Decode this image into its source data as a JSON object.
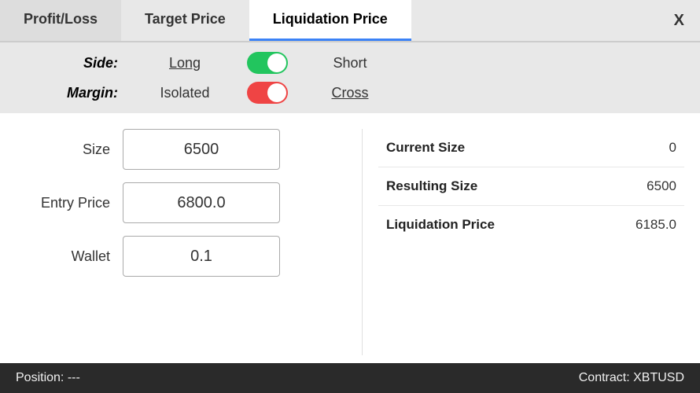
{
  "tabs": [
    {
      "id": "profit-loss",
      "label": "Profit/Loss",
      "active": false
    },
    {
      "id": "target-price",
      "label": "Target Price",
      "active": false
    },
    {
      "id": "liquidation-price",
      "label": "Liquidation Price",
      "active": true
    }
  ],
  "close_button": "X",
  "options": {
    "side": {
      "label": "Side:",
      "left": "Long",
      "right": "Short",
      "toggle_state": "green"
    },
    "margin": {
      "label": "Margin:",
      "left": "Isolated",
      "right": "Cross",
      "toggle_state": "red-right"
    }
  },
  "inputs": [
    {
      "id": "size",
      "label": "Size",
      "value": "6500"
    },
    {
      "id": "entry-price",
      "label": "Entry Price",
      "value": "6800.0"
    },
    {
      "id": "wallet",
      "label": "Wallet",
      "value": "0.1"
    }
  ],
  "info_panel": [
    {
      "key": "Current Size",
      "value": "0"
    },
    {
      "key": "Resulting Size",
      "value": "6500"
    },
    {
      "key": "Liquidation Price",
      "value": "6185.0"
    }
  ],
  "status_bar": {
    "position": "Position: ---",
    "contract": "Contract: XBTUSD"
  }
}
